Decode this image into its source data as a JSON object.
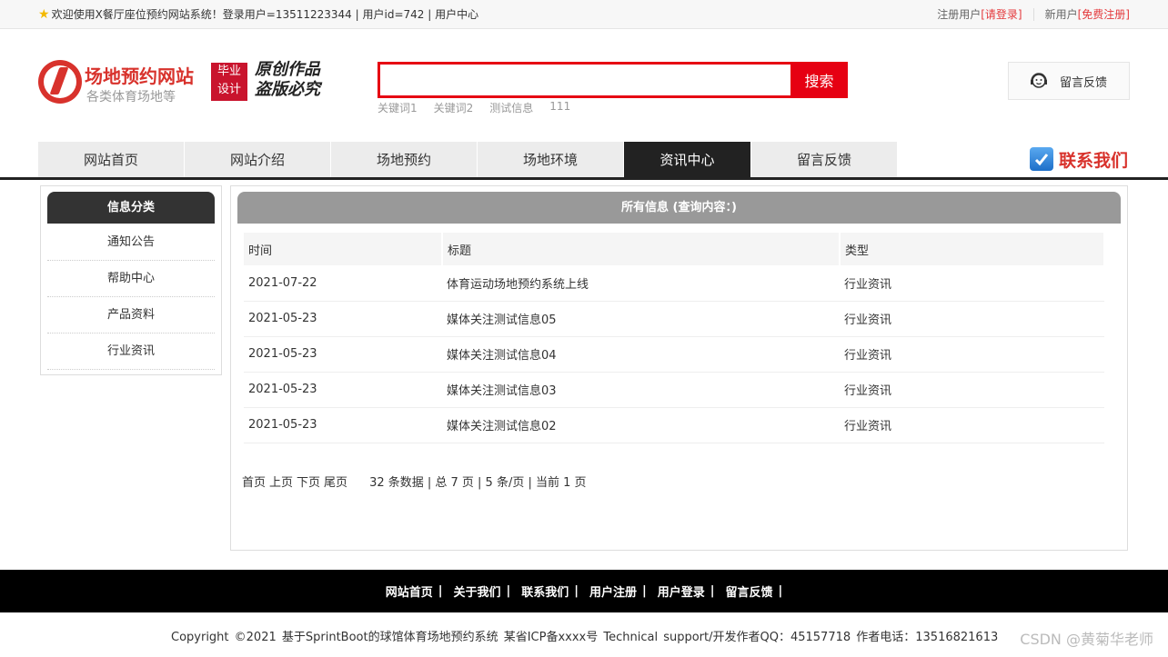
{
  "topbar": {
    "welcome": "欢迎使用X餐厅座位预约网站系统！登录用户=13511223344 | 用户id=742 | 用户中心",
    "registered_user": "注册用户",
    "login_link": "[请登录]",
    "new_user": "新用户",
    "register_link": "[免费注册]"
  },
  "header": {
    "logo_title": "场地预约网站",
    "logo_sub": "各类体育场地等",
    "badge_line1": "毕业",
    "badge_line2": "设计",
    "slogan_line1": "原创作品",
    "slogan_line2": "盗版必究",
    "search_placeholder": "",
    "search_button": "搜索",
    "hotwords": [
      "关键词1",
      "关键词2",
      "测试信息",
      "111"
    ],
    "feedback_label": "留言反馈"
  },
  "nav": {
    "items": [
      "网站首页",
      "网站介绍",
      "场地预约",
      "场地环境",
      "资讯中心",
      "留言反馈"
    ],
    "active_index": 4,
    "contact": "联系我们"
  },
  "sidebar": {
    "title": "信息分类",
    "items": [
      "通知公告",
      "帮助中心",
      "产品资料",
      "行业资讯"
    ]
  },
  "main": {
    "title": "所有信息 (查询内容：)",
    "columns": [
      "时间",
      "标题",
      "类型"
    ],
    "rows": [
      [
        "2021-07-22",
        "体育运动场地预约系统上线",
        "行业资讯"
      ],
      [
        "2021-05-23",
        "媒体关注测试信息05",
        "行业资讯"
      ],
      [
        "2021-05-23",
        "媒体关注测试信息04",
        "行业资讯"
      ],
      [
        "2021-05-23",
        "媒体关注测试信息03",
        "行业资讯"
      ],
      [
        "2021-05-23",
        "媒体关注测试信息02",
        "行业资讯"
      ]
    ],
    "pager": {
      "first": "首页",
      "prev": "上页",
      "next": "下页",
      "last": "尾页",
      "stats": "32 条数据 | 总 7 页 | 5 条/页 | 当前 1 页"
    }
  },
  "footer": {
    "links": [
      "网站首页",
      "关于我们",
      "联系我们",
      "用户注册",
      "用户登录",
      "留言反馈"
    ],
    "copyright": "Copyright ©2021 基于SprintBoot的球馆体育场地预约系统   某省ICP备xxxx号   Technical support/开发作者QQ：45157718   作者电话：13516821613",
    "watermark": "CSDN @黄菊华老师"
  },
  "colors": {
    "brand_red": "#e60012",
    "nav_active": "#222222"
  }
}
